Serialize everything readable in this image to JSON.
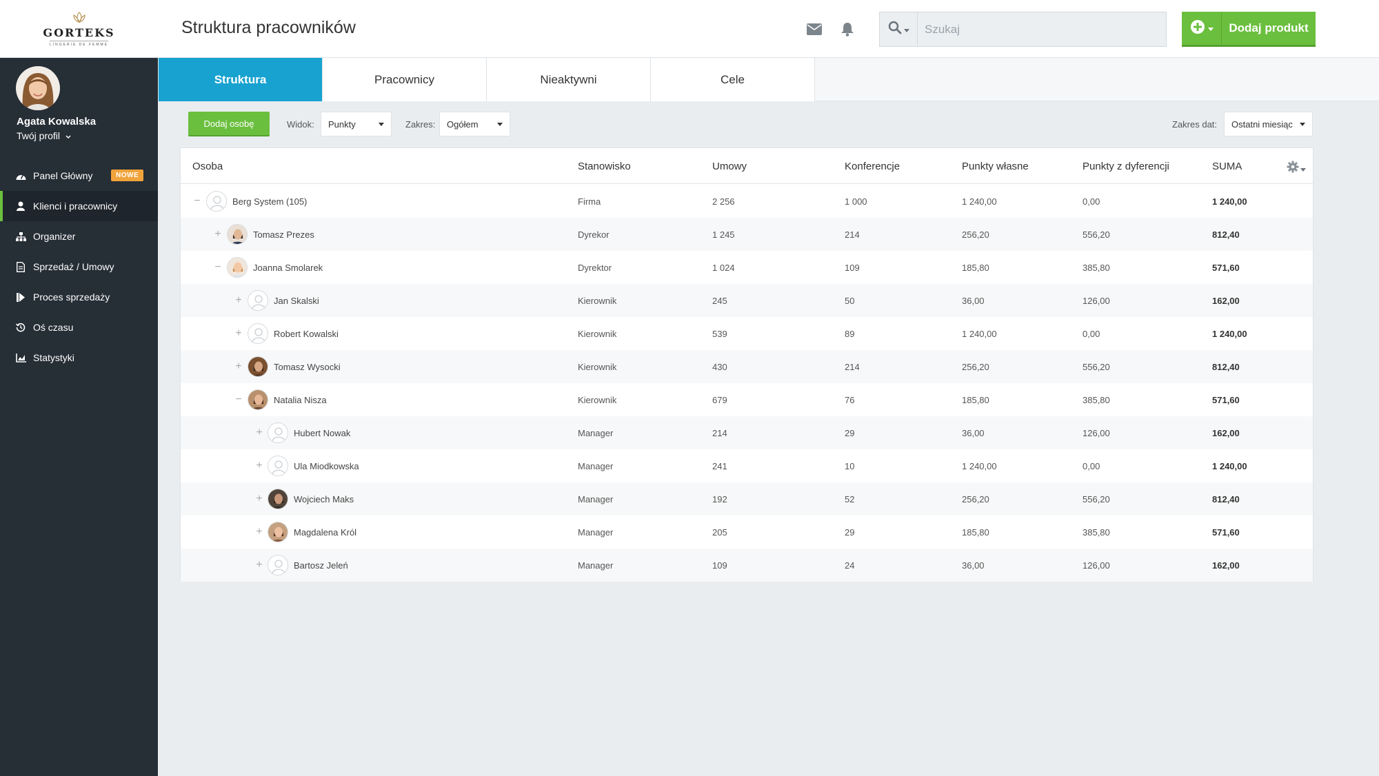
{
  "brand": {
    "name": "GORTEKS",
    "tagline": "LINGERIE DE FEMME"
  },
  "header": {
    "title": "Struktura pracowników",
    "search_placeholder": "Szukaj",
    "add_product_label": "Dodaj produkt"
  },
  "user": {
    "name": "Agata Kowalska",
    "profile_link": "Twój profil"
  },
  "sidebar": {
    "items": [
      {
        "label": "Panel Główny",
        "icon": "dashboard-icon",
        "badge": "NOWE"
      },
      {
        "label": "Klienci i pracownicy",
        "icon": "user-icon",
        "active": true
      },
      {
        "label": "Organizer",
        "icon": "sitemap-icon"
      },
      {
        "label": "Sprzedaż / Umowy",
        "icon": "document-icon"
      },
      {
        "label": "Proces sprzedaży",
        "icon": "process-icon"
      },
      {
        "label": "Oś czasu",
        "icon": "history-icon"
      },
      {
        "label": "Statystyki",
        "icon": "chart-icon"
      }
    ]
  },
  "tabs": [
    {
      "label": "Struktura",
      "active": true
    },
    {
      "label": "Pracownicy"
    },
    {
      "label": "Nieaktywni"
    },
    {
      "label": "Cele"
    }
  ],
  "toolbar": {
    "add_person_label": "Dodaj osobę",
    "view_label": "Widok:",
    "view_value": "Punkty",
    "scope_label": "Zakres:",
    "scope_value": "Ogółem",
    "date_range_label": "Zakres dat:",
    "date_range_value": "Ostatni miesiąc"
  },
  "table": {
    "columns": [
      "Osoba",
      "Stanowisko",
      "Umowy",
      "Konferencje",
      "Punkty własne",
      "Punkty z dyferencji",
      "SUMA"
    ],
    "rows": [
      {
        "name": "Berg System (105)",
        "position": "Firma",
        "contracts": "2 256",
        "conferences": "1 000",
        "own_points": "1 240,00",
        "diff_points": "0,00",
        "sum": "1 240,00",
        "toggle": "−"
      },
      {
        "name": "Tomasz Prezes",
        "position": "Dyrekor",
        "contracts": "1 245",
        "conferences": "214",
        "own_points": "256,20",
        "diff_points": "556,20",
        "sum": "812,40",
        "toggle": "+"
      },
      {
        "name": "Joanna Smolarek",
        "position": "Dyrektor",
        "contracts": "1 024",
        "conferences": "109",
        "own_points": "185,80",
        "diff_points": "385,80",
        "sum": "571,60",
        "toggle": "−"
      },
      {
        "name": "Jan Skalski",
        "position": "Kierownik",
        "contracts": "245",
        "conferences": "50",
        "own_points": "36,00",
        "diff_points": "126,00",
        "sum": "162,00",
        "toggle": "+"
      },
      {
        "name": "Robert Kowalski",
        "position": "Kierownik",
        "contracts": "539",
        "conferences": "89",
        "own_points": "1 240,00",
        "diff_points": "0,00",
        "sum": "1 240,00",
        "toggle": "+"
      },
      {
        "name": "Tomasz Wysocki",
        "position": "Kierownik",
        "contracts": "430",
        "conferences": "214",
        "own_points": "256,20",
        "diff_points": "556,20",
        "sum": "812,40",
        "toggle": "+"
      },
      {
        "name": "Natalia Nisza",
        "position": "Kierownik",
        "contracts": "679",
        "conferences": "76",
        "own_points": "185,80",
        "diff_points": "385,80",
        "sum": "571,60",
        "toggle": "−"
      },
      {
        "name": "Hubert Nowak",
        "position": "Manager",
        "contracts": "214",
        "conferences": "29",
        "own_points": "36,00",
        "diff_points": "126,00",
        "sum": "162,00",
        "toggle": "+"
      },
      {
        "name": "Ula Miodkowska",
        "position": "Manager",
        "contracts": "241",
        "conferences": "10",
        "own_points": "1 240,00",
        "diff_points": "0,00",
        "sum": "1 240,00",
        "toggle": "+"
      },
      {
        "name": "Wojciech Maks",
        "position": "Manager",
        "contracts": "192",
        "conferences": "52",
        "own_points": "256,20",
        "diff_points": "556,20",
        "sum": "812,40",
        "toggle": "+"
      },
      {
        "name": "Magdalena Król",
        "position": "Manager",
        "contracts": "205",
        "conferences": "29",
        "own_points": "185,80",
        "diff_points": "385,80",
        "sum": "571,60",
        "toggle": "+"
      },
      {
        "name": "Bartosz Jeleń",
        "position": "Manager",
        "contracts": "109",
        "conferences": "24",
        "own_points": "36,00",
        "diff_points": "126,00",
        "sum": "162,00",
        "toggle": "+"
      }
    ]
  },
  "colors": {
    "accent_green": "#6bbf3e",
    "accent_blue": "#17a2d0",
    "sidebar_bg": "#262e36",
    "badge_orange": "#f0a33a"
  }
}
